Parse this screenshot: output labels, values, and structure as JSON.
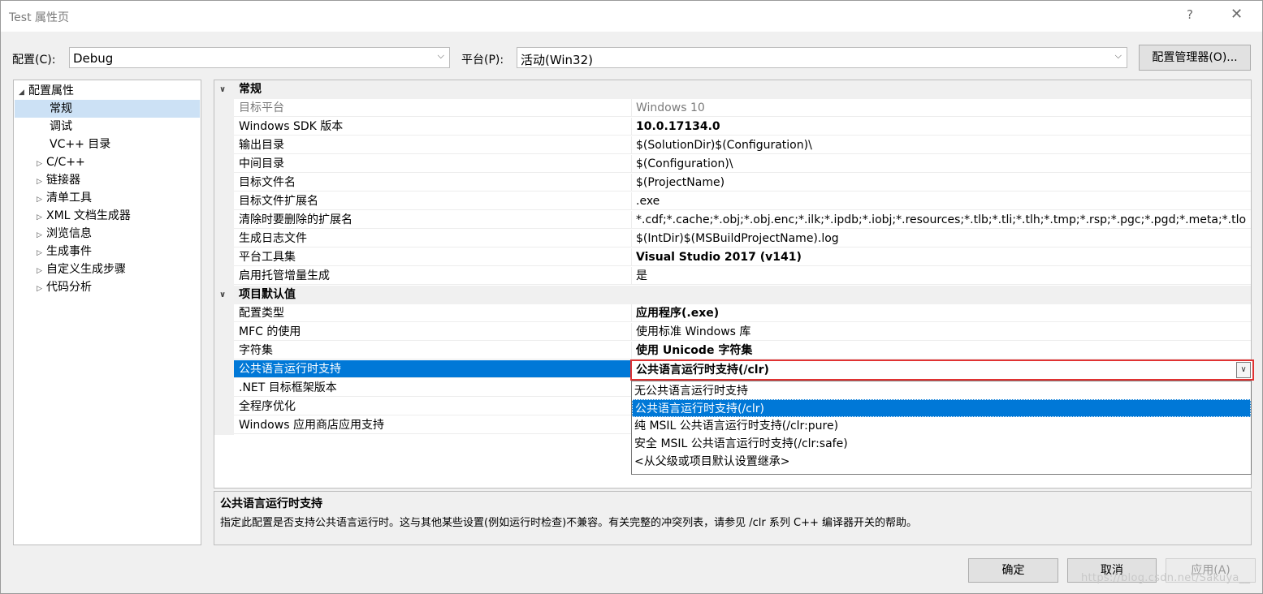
{
  "window": {
    "title": "Test 属性页",
    "help_glyph": "?",
    "close_glyph": "✕"
  },
  "toolbar": {
    "config_label": "配置(C):",
    "config_value": "Debug",
    "platform_label": "平台(P):",
    "platform_value": "活动(Win32)",
    "manager_button": "配置管理器(O)..."
  },
  "tree": {
    "root": "配置属性",
    "items": [
      "常规",
      "调试",
      "VC++ 目录",
      "C/C++",
      "链接器",
      "清单工具",
      "XML 文档生成器",
      "浏览信息",
      "生成事件",
      "自定义生成步骤",
      "代码分析"
    ],
    "selected": "常规"
  },
  "grid": {
    "categories": [
      "常规",
      "项目默认值"
    ],
    "general": [
      {
        "name": "目标平台",
        "value": "Windows 10"
      },
      {
        "name": "Windows SDK 版本",
        "value": "10.0.17134.0"
      },
      {
        "name": "输出目录",
        "value": "$(SolutionDir)$(Configuration)\\"
      },
      {
        "name": "中间目录",
        "value": "$(Configuration)\\"
      },
      {
        "name": "目标文件名",
        "value": "$(ProjectName)"
      },
      {
        "name": "目标文件扩展名",
        "value": ".exe"
      },
      {
        "name": "清除时要删除的扩展名",
        "value": "*.cdf;*.cache;*.obj;*.obj.enc;*.ilk;*.ipdb;*.iobj;*.resources;*.tlb;*.tli;*.tlh;*.tmp;*.rsp;*.pgc;*.pgd;*.meta;*.tlo"
      },
      {
        "name": "生成日志文件",
        "value": "$(IntDir)$(MSBuildProjectName).log"
      },
      {
        "name": "平台工具集",
        "value": "Visual Studio 2017 (v141)"
      },
      {
        "name": "启用托管增量生成",
        "value": "是"
      }
    ],
    "defaults": [
      {
        "name": "配置类型",
        "value": "应用程序(.exe)"
      },
      {
        "name": "MFC 的使用",
        "value": "使用标准 Windows 库"
      },
      {
        "name": "字符集",
        "value": "使用 Unicode 字符集"
      },
      {
        "name": "公共语言运行时支持",
        "value": ""
      },
      {
        "name": ".NET 目标框架版本",
        "value": ""
      },
      {
        "name": "全程序优化",
        "value": ""
      },
      {
        "name": "Windows 应用商店应用支持",
        "value": ""
      }
    ]
  },
  "editor": {
    "value": "公共语言运行时支持(/clr)",
    "options": [
      "无公共语言运行时支持",
      "公共语言运行时支持(/clr)",
      "纯 MSIL 公共语言运行时支持(/clr:pure)",
      "安全 MSIL 公共语言运行时支持(/clr:safe)",
      "<从父级或项目默认设置继承>"
    ],
    "selected_option": "公共语言运行时支持(/clr)",
    "highlight_color": "#e03232"
  },
  "description": {
    "title": "公共语言运行时支持",
    "text": "指定此配置是否支持公共语言运行时。这与其他某些设置(例如运行时检查)不兼容。有关完整的冲突列表，请参见 /clr 系列 C++ 编译器开关的帮助。"
  },
  "buttons": {
    "ok": "确定",
    "cancel": "取消",
    "apply": "应用(A)"
  },
  "watermark": "https://blog.csdn.net/Sakuya__",
  "colors": {
    "selection": "#0078d7",
    "tree_selection": "#cce1f5"
  }
}
